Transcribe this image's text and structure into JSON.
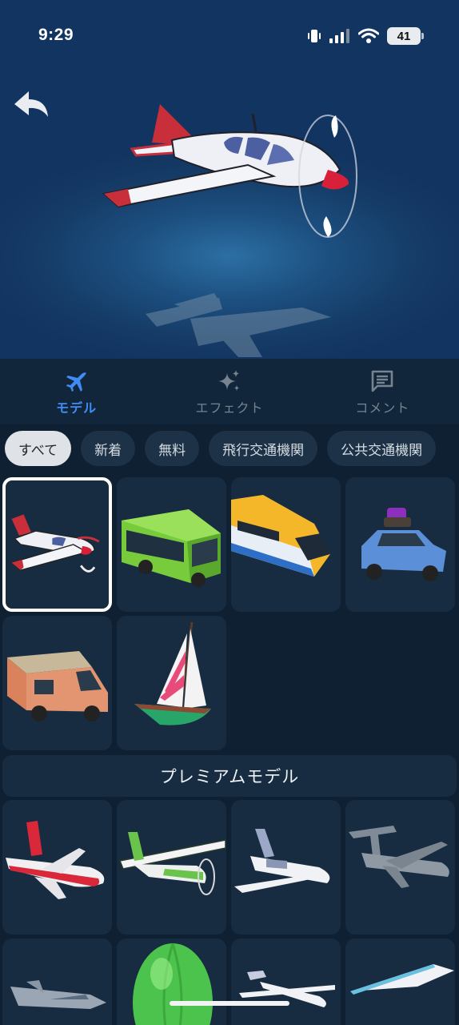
{
  "status_bar": {
    "time": "9:29",
    "battery": "41"
  },
  "hero": {
    "preview_model": "red-white-propeller-plane"
  },
  "tabs": [
    {
      "label": "モデル",
      "icon": "airplane-icon",
      "active": true
    },
    {
      "label": "エフェクト",
      "icon": "sparkles-icon",
      "active": false
    },
    {
      "label": "コメント",
      "icon": "comment-icon",
      "active": false
    }
  ],
  "filters": [
    "すべて",
    "新着",
    "無料",
    "飛行交通機関",
    "公共交通機関"
  ],
  "selected_filter": "すべて",
  "models": [
    {
      "name": "propeller-plane",
      "selected": true
    },
    {
      "name": "green-bus",
      "selected": false
    },
    {
      "name": "yellow-train",
      "selected": false
    },
    {
      "name": "blue-car-with-luggage",
      "selected": false
    },
    {
      "name": "camper-van",
      "selected": false
    },
    {
      "name": "sailboat",
      "selected": false
    }
  ],
  "premium": {
    "title": "プレミアムモデル",
    "models": [
      "red-jet-airliner",
      "green-cessna",
      "white-business-jet",
      "grey-cargo-plane",
      "fighter-jet",
      "hot-air-balloon",
      "glider",
      "hang-glider"
    ]
  },
  "colors": {
    "accent": "#3f8cf5",
    "background": "#0f2033",
    "tile": "#172c41"
  }
}
